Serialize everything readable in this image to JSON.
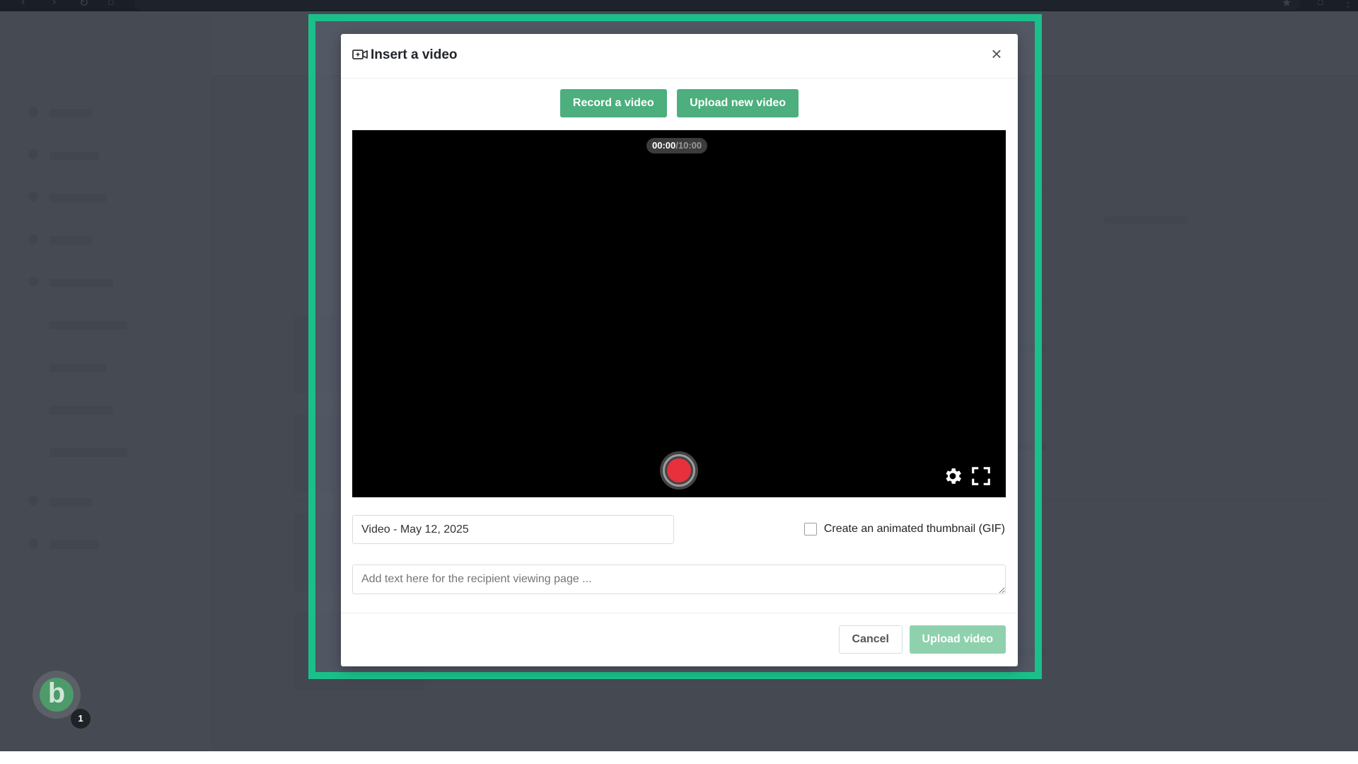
{
  "modal": {
    "title": "Insert a video",
    "title_icon": "video-camera-icon",
    "close_glyph": "×",
    "buttons": {
      "record": "Record a video",
      "upload_new": "Upload new video"
    },
    "player": {
      "timer_current": "00:00",
      "timer_separator": "/",
      "timer_max": "10:00",
      "settings_icon": "gear-icon",
      "fullscreen_icon": "fullscreen-icon"
    },
    "video_name_value": "Video - May 12, 2025",
    "gif_checkbox_label": "Create an animated thumbnail (GIF)",
    "gif_checked": false,
    "description_placeholder": "Add text here for the recipient viewing page ...",
    "footer": {
      "cancel": "Cancel",
      "upload": "Upload video"
    }
  },
  "chat_widget": {
    "logo_letter": "b",
    "badge_count": "1"
  },
  "colors": {
    "highlight_frame": "#1bbf8a",
    "primary_button": "#4caf7d",
    "primary_button_disabled": "#8fd1ad",
    "record_dot": "#e8303c",
    "overlay": "#191e28"
  }
}
